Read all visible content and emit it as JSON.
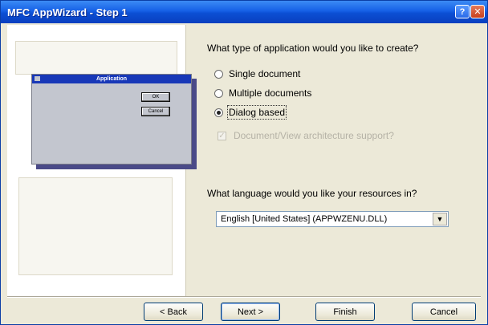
{
  "window": {
    "title": "MFC AppWizard - Step 1",
    "help_label": "?",
    "close_label": "✕"
  },
  "illustration": {
    "dialog_title": "Application",
    "ok_label": "OK",
    "cancel_label": "Cancel"
  },
  "app_type": {
    "question": "What type of application would you like to create?",
    "options": [
      {
        "label": "Single document",
        "checked": false
      },
      {
        "label": "Multiple documents",
        "checked": false
      },
      {
        "label": "Dialog based",
        "checked": true
      }
    ],
    "doc_view_label": "Document/View architecture support?",
    "doc_view_checked": true,
    "doc_view_enabled": false
  },
  "language": {
    "question": "What language would you like your resources in?",
    "selected": "English [United States] (APPWZENU.DLL)"
  },
  "buttons": {
    "back": "< Back",
    "next": "Next >",
    "finish": "Finish",
    "cancel": "Cancel"
  },
  "colors": {
    "titlebar": "#0b4fd4",
    "dialog_face": "#ece9d8",
    "mini_dialog_titlebar": "#1838b8"
  }
}
